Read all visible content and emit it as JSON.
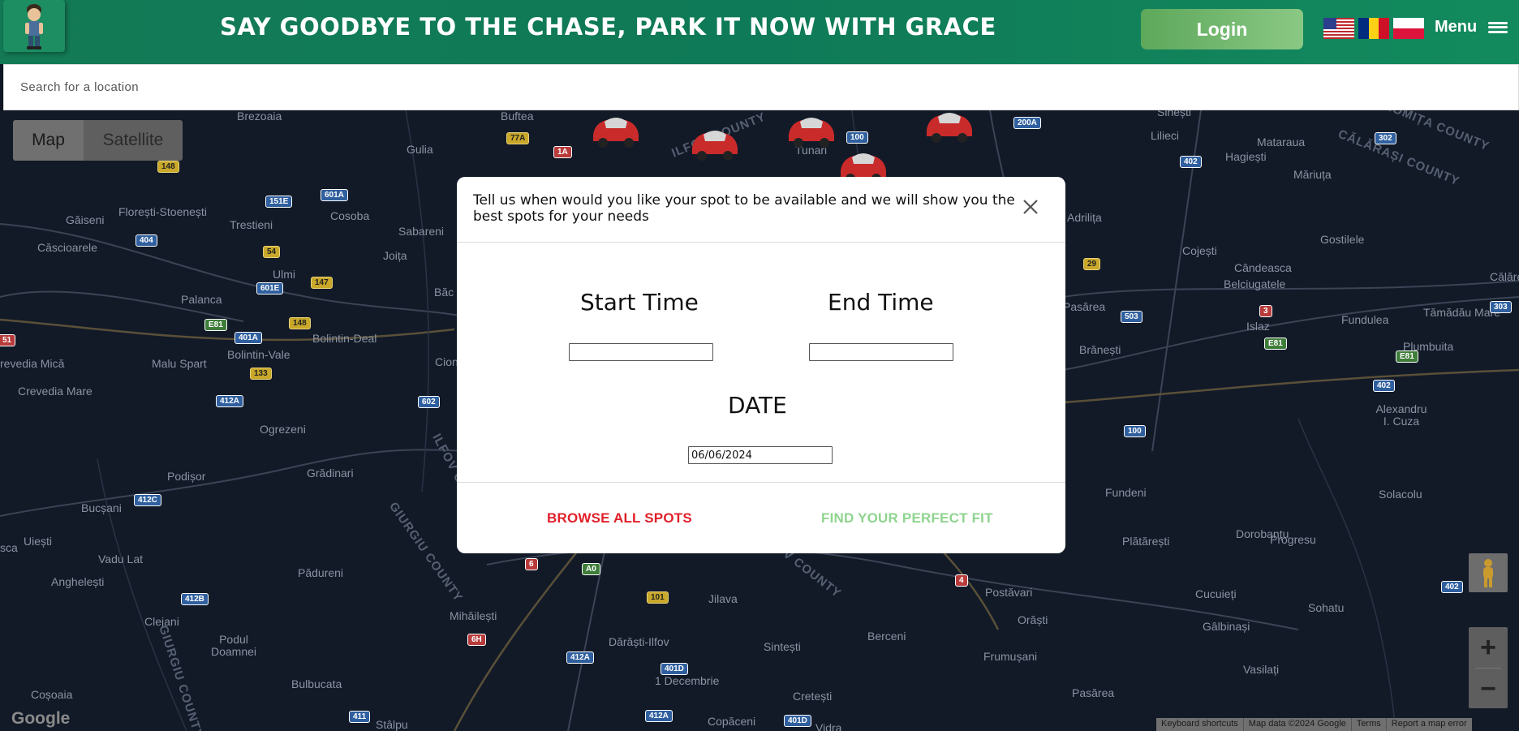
{
  "header": {
    "slogan": "SAY GOODBYE TO THE CHASE, PARK IT NOW WITH GRACE",
    "login_label": "Login",
    "menu_label": "Menu",
    "flags": [
      "us-flag-icon",
      "romania-flag-icon",
      "poland-flag-icon"
    ],
    "colors": {
      "header_bg": "#137a55",
      "login_bg": "#6db56a"
    }
  },
  "search": {
    "placeholder": "Search for a location",
    "value": ""
  },
  "map": {
    "type_buttons": {
      "map": "Map",
      "satellite": "Satellite"
    },
    "selected_type": "Map",
    "places": [
      "Brezoaia",
      "Buftea",
      "Gulia",
      "Tunari",
      "Sinești",
      "Lilieci",
      "Mataraua",
      "Hagiești",
      "Măriuța",
      "Găiseni",
      "Florești-Stoenești",
      "Cosoba",
      "Sabareni",
      "Trestieni",
      "Joița",
      "Adrilița",
      "Cojești",
      "Gostilele",
      "Cândeasca",
      "Belciugatele",
      "Călăre",
      "Căscioarele",
      "Ulmi",
      "Băc",
      "Pasărea",
      "Islaz",
      "Fundulea",
      "Tămădău Mare",
      "Palanca",
      "Bolintin-Deal",
      "Bolintin-Vale",
      "Malu Spart",
      "Cion",
      "Brănești",
      "Plumbuita",
      "revedia Mică",
      "Crevedia Mare",
      "Alexandru I. Cuza",
      "Ogrezeni",
      "Podișor",
      "Grădinari",
      "Fundeni",
      "Solacolu",
      "Bucșani",
      "Uiești",
      "Plătărești",
      "Dorobanțu",
      "Progresu",
      "Vadu Lat",
      "Anghelești",
      "Pădureni",
      "Postăvari",
      "Cucuieți",
      "Sohatu",
      "Clejani",
      "Mihăilești",
      "Jilava",
      "Orăști",
      "Gâlbinași",
      "Podul Doamnei",
      "Dărăști-Ilfov",
      "Sintești",
      "Berceni",
      "Frumușani",
      "Vasilați",
      "Coșoaia",
      "Bulbucata",
      "1 Decembrie",
      "Cretești",
      "Pasărea",
      "Stâlpu",
      "Copăceni",
      "Vidra",
      "sca"
    ],
    "counties": [
      "ILFOV COUNTY",
      "CĂLĂRAȘI COUNTY",
      "IALOMIȚA COUNTY",
      "GIURGIU COUNTY"
    ],
    "roads": [
      "148",
      "151E",
      "601A",
      "404",
      "54",
      "147",
      "601E",
      "E81",
      "401A",
      "148",
      "133",
      "412A",
      "602",
      "412C",
      "412B",
      "6",
      "A0",
      "101",
      "6H",
      "412A",
      "401D",
      "411",
      "412A",
      "401D",
      "77A",
      "1A",
      "100",
      "200A",
      "402",
      "302",
      "29",
      "503",
      "3",
      "E81",
      "E81",
      "402",
      "100",
      "4",
      "402",
      "303",
      "51"
    ],
    "google_label": "Google",
    "attribution": [
      "Keyboard shortcuts",
      "Map data ©2024 Google",
      "Terms",
      "Report a map error"
    ]
  },
  "modal": {
    "message": "Tell us when would you like your spot to be available and we will show you the best spots for your needs",
    "start_label": "Start Time",
    "end_label": "End Time",
    "start_value": "",
    "end_value": "",
    "date_label": "DATE",
    "date_value": "06/06/2024",
    "browse_label": "BROWSE ALL SPOTS",
    "find_label": "FIND YOUR PERFECT FIT",
    "colors": {
      "browse": "#e0202a",
      "find": "#8fd48f"
    }
  }
}
